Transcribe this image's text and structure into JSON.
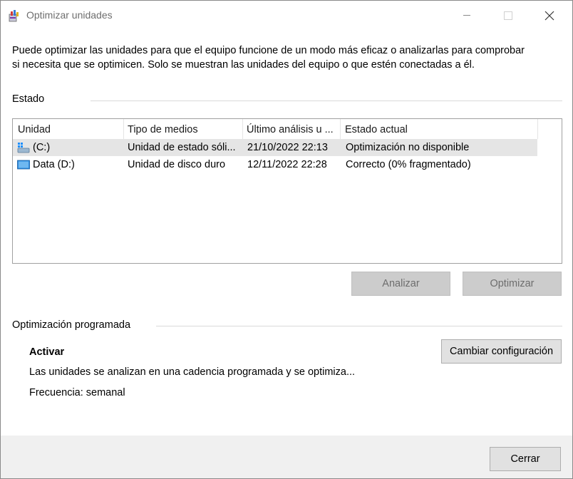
{
  "window": {
    "title": "Optimizar unidades"
  },
  "description": "Puede optimizar las unidades para que el equipo funcione de un modo más eficaz o analizarlas para comprobar si necesita que se optimicen. Solo se muestran las unidades del equipo o que estén conectadas a él.",
  "status_section": {
    "label": "Estado"
  },
  "drives_table": {
    "columns": [
      "Unidad",
      "Tipo de medios",
      "Último análisis u ...",
      "Estado actual"
    ],
    "rows": [
      {
        "unit": "(C:)",
        "media_type": "Unidad de estado sóli...",
        "last_run": "21/10/2022 22:13",
        "status": "Optimización no disponible",
        "icon": "system-drive-icon",
        "selected": true
      },
      {
        "unit": "Data (D:)",
        "media_type": "Unidad de disco duro",
        "last_run": "12/11/2022 22:28",
        "status": "Correcto (0% fragmentado)",
        "icon": "hard-drive-icon",
        "selected": false
      }
    ]
  },
  "buttons": {
    "analyze": "Analizar",
    "optimize": "Optimizar",
    "change_settings": "Cambiar configuración",
    "close": "Cerrar"
  },
  "scheduled": {
    "label": "Optimización programada",
    "state": "Activar",
    "description": "Las unidades se analizan en una cadencia programada y se optimiza...",
    "frequency": "Frecuencia: semanal"
  }
}
